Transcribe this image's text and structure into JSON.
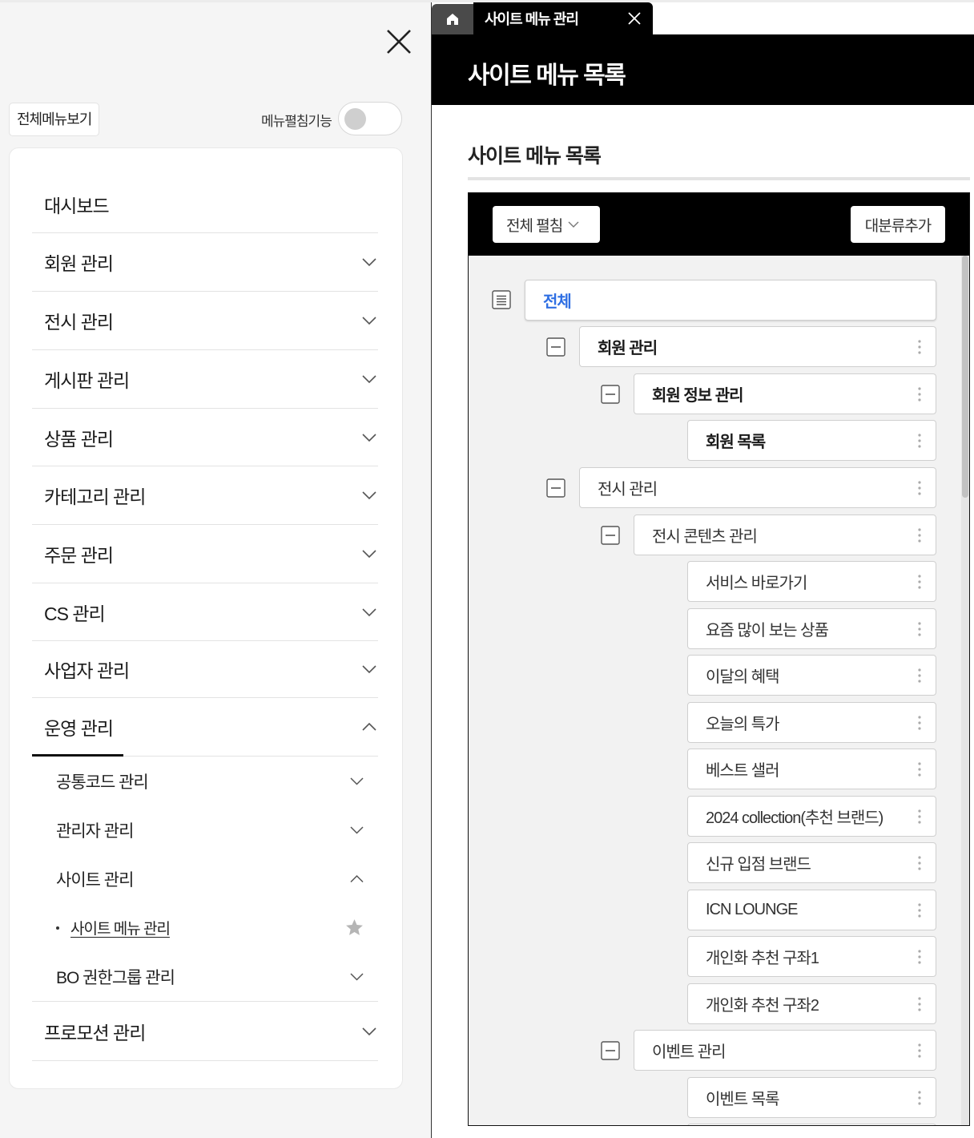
{
  "sidebar": {
    "all_menu_label": "전체메뉴보기",
    "fold_label": "메뉴펼침기능",
    "fold_enabled": false,
    "items": [
      {
        "label": "대시보드"
      },
      {
        "label": "회원 관리"
      },
      {
        "label": "전시 관리"
      },
      {
        "label": "게시판 관리"
      },
      {
        "label": "상품 관리"
      },
      {
        "label": "카테고리 관리"
      },
      {
        "label": "주문 관리"
      },
      {
        "label": "CS 관리"
      },
      {
        "label": "사업자 관리"
      },
      {
        "label": "운영 관리"
      },
      {
        "label": "프로모션 관리"
      }
    ],
    "operation_sub": [
      {
        "label": "공통코드 관리"
      },
      {
        "label": "관리자 관리"
      },
      {
        "label": "사이트 관리"
      },
      {
        "label": "사이트 메뉴 관리"
      },
      {
        "label": "BO 권한그룹 관리"
      }
    ]
  },
  "tabs": {
    "active_label": "사이트 메뉴 관리"
  },
  "page": {
    "header_title": "사이트 메뉴 목록",
    "section_title": "사이트 메뉴 목록",
    "expand_all_label": "전체 펼침",
    "add_category_label": "대분류추가"
  },
  "tree": {
    "root": "전체",
    "nodes": [
      {
        "label": "회원 관리"
      },
      {
        "label": "회원 정보 관리"
      },
      {
        "label": "회원 목록"
      },
      {
        "label": "전시 관리"
      },
      {
        "label": "전시 콘텐츠 관리"
      },
      {
        "label": "서비스 바로가기"
      },
      {
        "label": "요즘 많이 보는 상품"
      },
      {
        "label": "이달의 혜택"
      },
      {
        "label": "오늘의 특가"
      },
      {
        "label": "베스트 샐러"
      },
      {
        "label": "2024 collection(추천 브랜드)"
      },
      {
        "label": "신규 입점 브랜드"
      },
      {
        "label": "ICN LOUNGE"
      },
      {
        "label": "개인화 추천 구좌1"
      },
      {
        "label": "개인화 추천 구좌2"
      },
      {
        "label": "이벤트 관리"
      },
      {
        "label": "이벤트 목록"
      }
    ]
  },
  "colors": {
    "root_node_text": "#2f6fe3",
    "header_bg": "#000000",
    "sidebar_bg": "#f5f5f5"
  }
}
